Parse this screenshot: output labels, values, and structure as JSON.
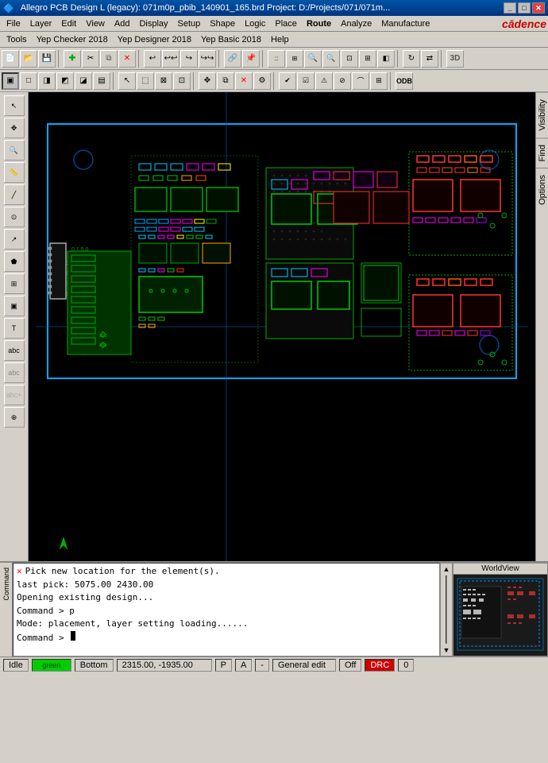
{
  "titlebar": {
    "title": "Allegro PCB Design L (legacy): 071m0p_pbib_140901_165.brd  Project: D:/Projects/071/071m...",
    "controls": [
      "minimize",
      "maximize",
      "close"
    ]
  },
  "menubar": {
    "items": [
      "File",
      "Layer",
      "Edit",
      "View",
      "Add",
      "Display",
      "Setup",
      "Shape",
      "Logic",
      "Place",
      "Route",
      "Analyze",
      "Manufacture"
    ],
    "logo": "cādence"
  },
  "menubar2": {
    "items": [
      "Tools",
      "Yep Checker 2018",
      "Yep Designer 2018",
      "Yep Basic 2018",
      "Help"
    ]
  },
  "toolbar1": {
    "buttons": [
      "new",
      "open",
      "save",
      "separator",
      "add-connect",
      "separator",
      "undo",
      "undo2",
      "redo",
      "redo2",
      "separator",
      "rats-nest",
      "lock",
      "separator",
      "grid",
      "grid2",
      "zoom-in",
      "zoom-out",
      "zoom-fit",
      "zoom-area",
      "zoom-prev",
      "separator",
      "rotate",
      "flip",
      "separator",
      "3d"
    ]
  },
  "toolbar2": {
    "buttons": [
      "layer1",
      "layer2",
      "layer3",
      "layer4",
      "layer5",
      "layer6",
      "separator",
      "cursor",
      "select",
      "select2",
      "select3",
      "separator",
      "move",
      "copy",
      "delete",
      "separator",
      "check",
      "check2",
      "check3"
    ]
  },
  "left_toolbar": {
    "buttons": [
      "select-icon",
      "pan-icon",
      "zoom-in-icon",
      "zoom-out-icon",
      "measure-icon",
      "add-connect-icon",
      "route-icon",
      "via-icon",
      "fanout-icon",
      "component-icon",
      "text-icon",
      "text2-icon",
      "abc-icon",
      "abc2-icon",
      "pin-icon"
    ]
  },
  "right_sidebar": {
    "tabs": [
      "Visibility",
      "Find",
      "Options"
    ]
  },
  "canvas": {
    "background": "#000000",
    "board_color": "#00aaff"
  },
  "log_area": {
    "lines": [
      "Pick new location for the element(s).",
      "last pick: 5075.00 2430.00",
      "Opening existing design...",
      "Command > p",
      "Mode: placement, layer setting loading......",
      "Command >"
    ]
  },
  "statusbar": {
    "mode": "Idle",
    "signal": "green",
    "layer": "Bottom",
    "coordinates": "2315.00, -1935.00",
    "p_indicator": "P",
    "a_indicator": "A",
    "separator": "-",
    "mode2": "General edit",
    "off_label": "Off",
    "drc_label": "DRC",
    "count": "0"
  },
  "bottom_panel": {
    "command_label": "Command",
    "worldview_label": "WorldView"
  }
}
